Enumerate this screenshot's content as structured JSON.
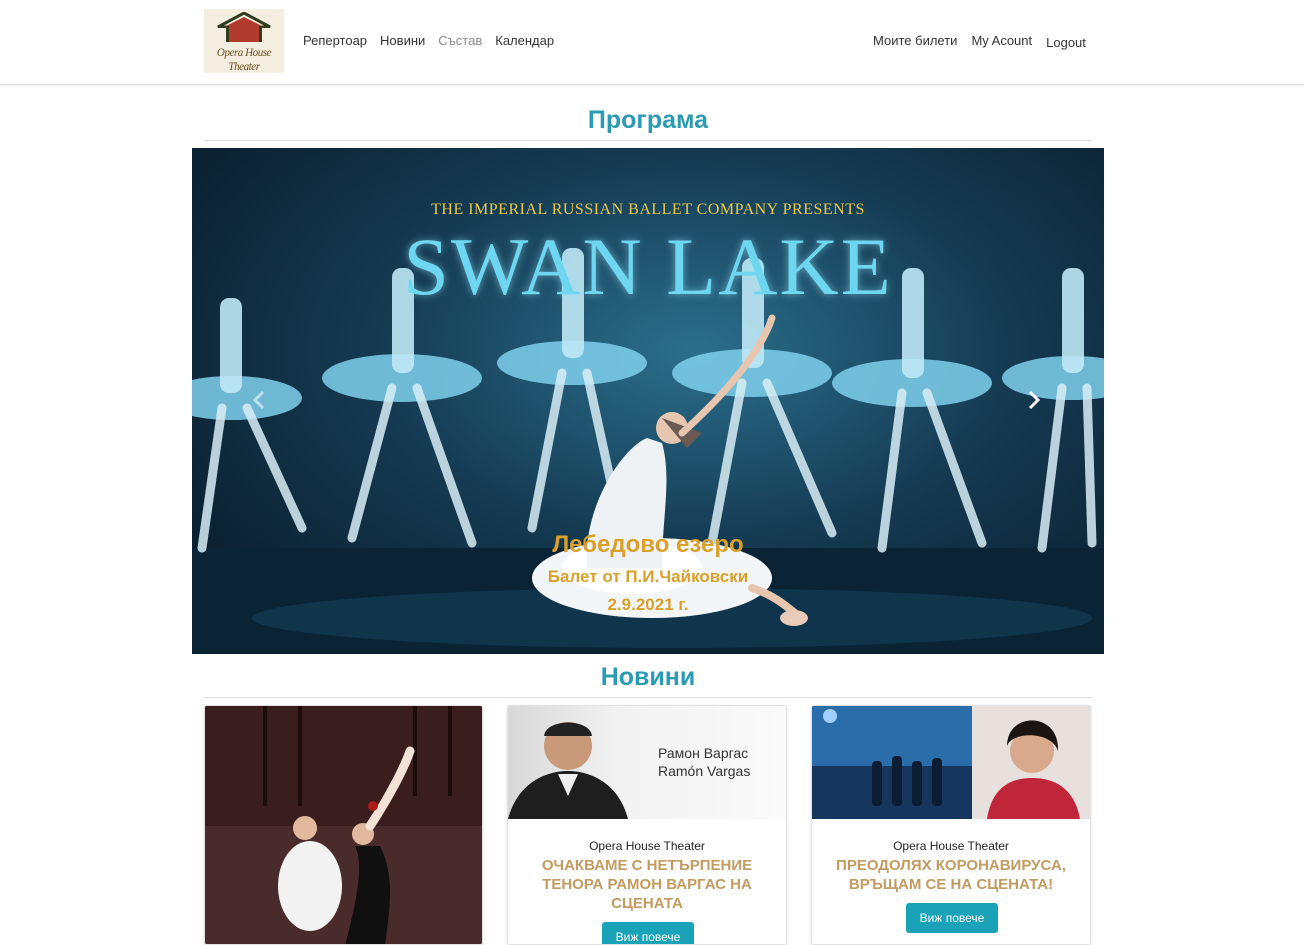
{
  "logo": {
    "text": "Opera House Theater"
  },
  "nav": {
    "left": [
      {
        "label": "Репертоар"
      },
      {
        "label": "Новини"
      },
      {
        "label": "Състав"
      },
      {
        "label": "Календар"
      }
    ],
    "right": [
      {
        "label": "Моите билети"
      },
      {
        "label": "My Acount"
      },
      {
        "label": "Logout"
      }
    ]
  },
  "program": {
    "title": "Програма",
    "slide": {
      "presents": "THE IMPERIAL RUSSIAN BALLET COMPANY PRESENTS",
      "image_title": "SWAN LAKE",
      "caption_title": "Лебедово езеро",
      "caption_subtitle": "Балет от П.И.Чайковски",
      "caption_date": "2.9.2021 г."
    }
  },
  "news": {
    "title": "Новини",
    "cards": [
      {
        "source": "",
        "heading": "",
        "button": ""
      },
      {
        "image_text_1": "Рамон Варгас",
        "image_text_2": "Ramón Vargas",
        "source": "Opera House Theater",
        "heading": "ОЧАКВАМЕ С НЕТЪРПЕНИЕ ТЕНОРА РАМОН ВАРГАС НА СЦЕНАТА",
        "button": "Виж повече"
      },
      {
        "source": "Opera House Theater",
        "heading": "ПРЕОДОЛЯХ КОРОНАВИРУСА, ВРЪЩАМ СЕ НА СЦЕНАТА!",
        "button": "Виж повече"
      }
    ]
  }
}
